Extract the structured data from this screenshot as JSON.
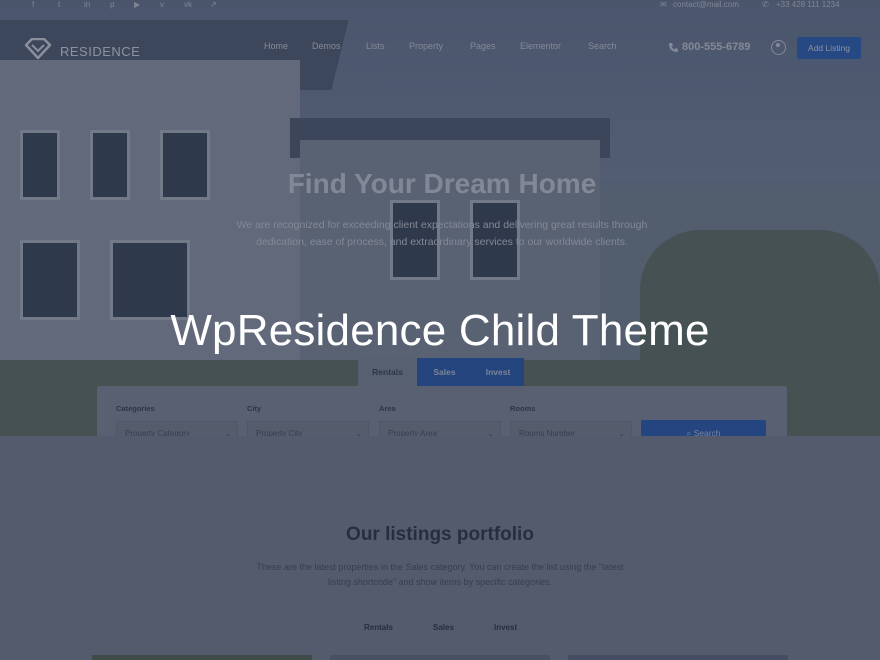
{
  "topbar": {
    "social_icons": [
      "facebook-icon",
      "twitter-icon",
      "linkedin-icon",
      "pinterest-icon",
      "youtube-icon",
      "vimeo-icon",
      "vk-icon",
      "telegram-icon"
    ],
    "social_glyphs": [
      "f",
      "t",
      "in",
      "p",
      "▶",
      "v",
      "vk",
      "↗"
    ],
    "email": "contact@mail.com",
    "phone": "+33 428 111 1234"
  },
  "nav": {
    "logo": "RESIDENCE",
    "menu": [
      "Home",
      "Demos",
      "Lists",
      "Property",
      "Pages",
      "Elementor",
      "Search"
    ],
    "phone": "800-555-6789",
    "add_listing": "Add Listing"
  },
  "hero": {
    "title": "Find Your Dream Home",
    "subtitle": "We are recognized for exceeding client expectations and delivering great results through dedication, ease of process, and extraordinary services to our worldwide clients."
  },
  "search": {
    "tabs": [
      "Rentals",
      "Sales",
      "Invest"
    ],
    "active_tab": "Rentals",
    "fields": [
      {
        "label": "Categories",
        "value": "Property Category"
      },
      {
        "label": "City",
        "value": "Property City"
      },
      {
        "label": "Area",
        "value": "Property Area"
      },
      {
        "label": "Rooms",
        "value": "Rooms Number"
      }
    ],
    "button": "Search"
  },
  "listings": {
    "title": "Our listings portfolio",
    "subtitle": "These are the latest properties in the Sales category. You can create the list using the \"latest listing shortcode\" and show items by specific categories.",
    "tabs": [
      "Rentals",
      "Sales",
      "Invest"
    ]
  },
  "overlay": {
    "caption": "WpResidence Child Theme"
  },
  "colors": {
    "accent": "#2f66c4",
    "overlay": "#1c2436"
  }
}
